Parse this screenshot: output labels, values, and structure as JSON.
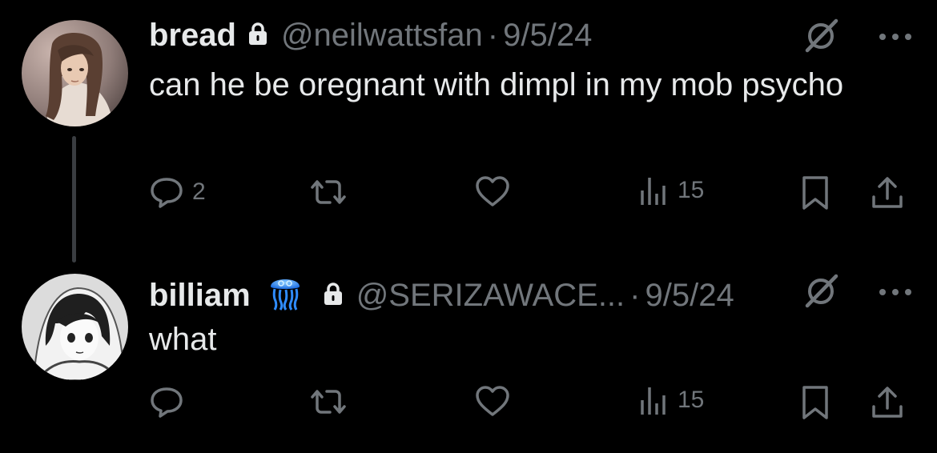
{
  "posts": [
    {
      "display_name": "bread",
      "handle": "@neilwattsfan",
      "separator": "·",
      "date": "9/5/24",
      "text": "can he be oregnant with dimpl in my mob psycho",
      "reply_count": "2",
      "repost_count": "",
      "like_count": "",
      "view_count": "15",
      "icons": [
        "lock-icon",
        "grok-icon",
        "more-icon",
        "reply-icon",
        "repost-icon",
        "like-icon",
        "views-icon",
        "bookmark-icon",
        "share-icon"
      ]
    },
    {
      "display_name": "billiam",
      "handle": "@SERIZAWACE...",
      "separator": "·",
      "date": "9/5/24",
      "text": "what",
      "reply_count": "",
      "repost_count": "",
      "like_count": "",
      "view_count": "15",
      "icons": [
        "jellyfish-emoji",
        "lock-icon",
        "grok-icon",
        "more-icon",
        "reply-icon",
        "repost-icon",
        "like-icon",
        "views-icon",
        "bookmark-icon",
        "share-icon"
      ]
    }
  ],
  "colors": {
    "background": "#000000",
    "primary_text": "#e7e9ea",
    "secondary_text": "#71767b",
    "thread_line": "#3a3d41",
    "jellyfish": "#2f8cff"
  }
}
